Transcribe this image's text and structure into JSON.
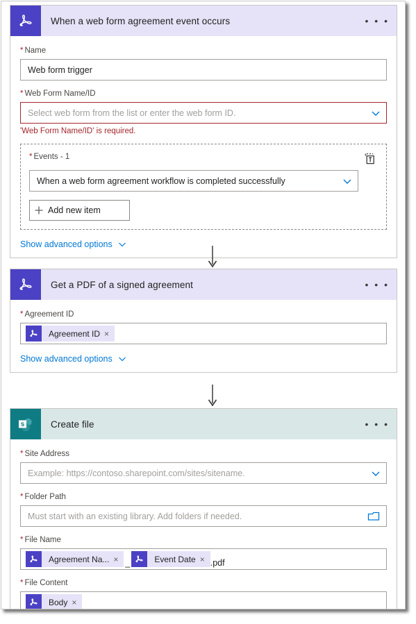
{
  "flow": {
    "cards": [
      {
        "id": "trigger",
        "app": "adobe-acrobat-sign",
        "title": "When a web form agreement event occurs",
        "more_label": "• • •",
        "fields": {
          "name": {
            "label": "Name",
            "value": "Web form trigger",
            "required": true
          },
          "web_form": {
            "label": "Web Form Name/ID",
            "placeholder": "Select web form from the list or enter the web form ID.",
            "required": true,
            "error": "'Web Form Name/ID' is required."
          },
          "events": {
            "label": "Events - 1",
            "required": true,
            "selected": "When a web form agreement workflow is completed successfully",
            "add_item_label": "Add new item",
            "delete_icon": "trash-icon"
          }
        },
        "advanced_label": "Show advanced options"
      },
      {
        "id": "get-pdf",
        "app": "adobe-acrobat-sign",
        "title": "Get a PDF of a signed agreement",
        "more_label": "• • •",
        "fields": {
          "agreement_id": {
            "label": "Agreement ID",
            "required": true,
            "tokens": [
              {
                "label": "Agreement ID",
                "remove": "×"
              }
            ]
          }
        },
        "advanced_label": "Show advanced options"
      },
      {
        "id": "create-file",
        "app": "sharepoint",
        "title": "Create file",
        "more_label": "• • •",
        "fields": {
          "site_address": {
            "label": "Site Address",
            "required": true,
            "placeholder": "Example: https://contoso.sharepoint.com/sites/sitename."
          },
          "folder_path": {
            "label": "Folder Path",
            "required": true,
            "placeholder": "Must start with an existing library. Add folders if needed.",
            "picker_icon": "folder-icon"
          },
          "file_name": {
            "label": "File Name",
            "required": true,
            "tokens": [
              {
                "label": "Agreement Na...",
                "remove": "×"
              },
              {
                "label": "Event Date",
                "remove": "×"
              }
            ],
            "separator": "_",
            "suffix": ".pdf"
          },
          "file_content": {
            "label": "File Content",
            "required": true,
            "tokens": [
              {
                "label": "Body",
                "remove": "×"
              }
            ]
          }
        }
      }
    ]
  },
  "colors": {
    "acrobat_icon": "#4b41c4",
    "acrobat_header": "#e6e3f8",
    "sharepoint_icon": "#0f7c83",
    "sharepoint_header": "#d9e7e7",
    "required_red": "#a4262c",
    "link_blue": "#0078d4",
    "border_gray": "#a19f9d"
  },
  "icons": {
    "required_star": "*",
    "chevron_down": "chevron-down-icon",
    "plus": "+",
    "arrow_down": "arrow-down-icon"
  }
}
